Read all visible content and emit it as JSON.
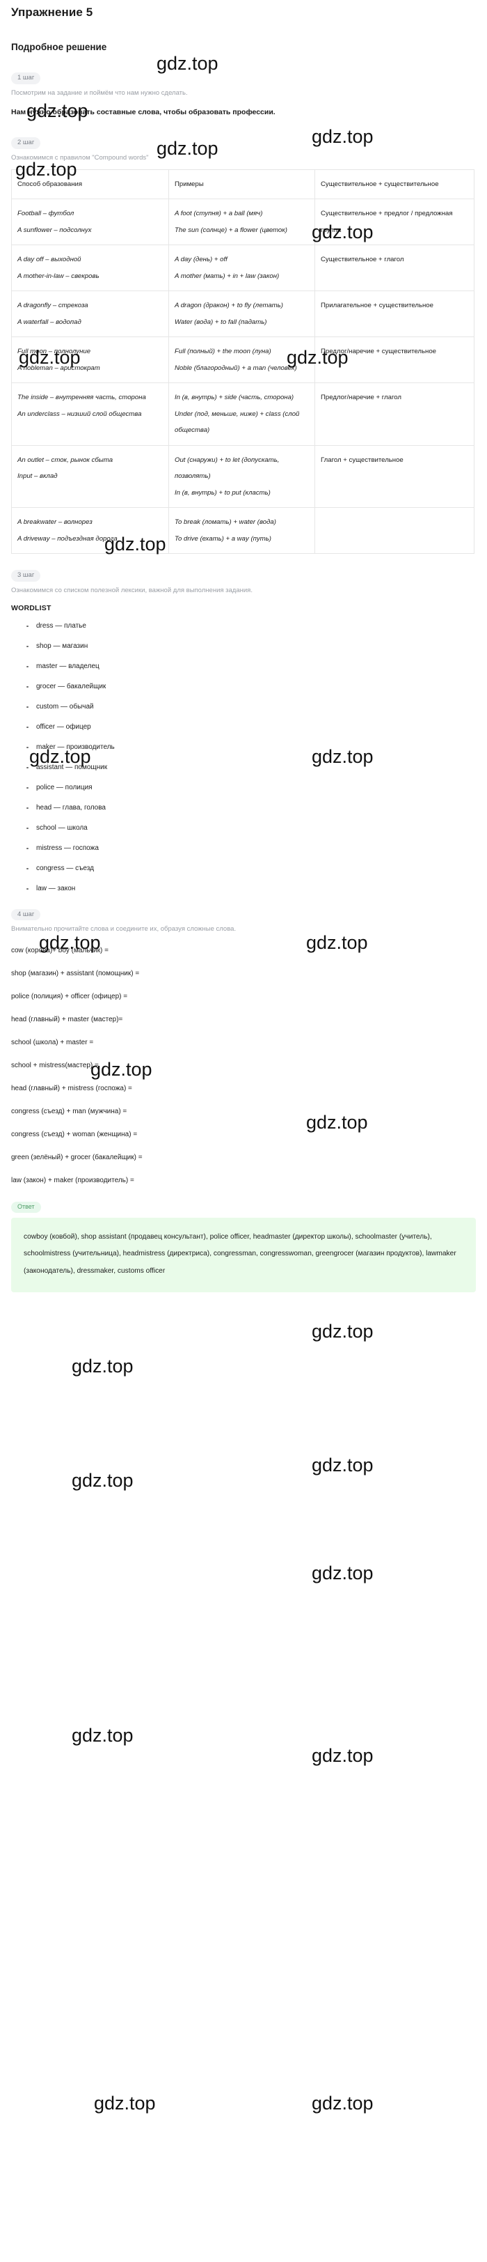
{
  "exercise": {
    "title": "Упражнение 5"
  },
  "solution": {
    "title": "Подробное решение"
  },
  "steps": {
    "step1": {
      "badge": "1 шаг",
      "text": "Посмотрим на задание и поймём что нам нужно сделать.",
      "bold": "Нам нужно образовать составные слова, чтобы образовать профессии."
    },
    "step2": {
      "badge": "2 шаг",
      "text": "Ознакомимся с правилом \"Compound words\""
    },
    "step3": {
      "badge": "3 шаг",
      "text": "Ознакомимся со списком полезной лексики, важной для выполнения задания.",
      "wordlist_title": "WORDLIST"
    },
    "step4": {
      "badge": "4 шаг",
      "text": "Внимательно прочитайте слова и соедините их, образуя сложные слова."
    }
  },
  "table": {
    "headers": [
      "Способ образования",
      "Примеры",
      "Существительное + существительное"
    ],
    "rows": [
      {
        "col1": [
          "Football – футбол",
          "A sunflower – подсолнух"
        ],
        "col2": [
          "A foot (ступня) + a ball (мяч)",
          "The sun (солнце) + a flower (цветок)"
        ],
        "col3": "Существительное + предлог / предложная группа"
      },
      {
        "col1": [
          "A day off – выходной",
          "A mother-in-law – свекровь"
        ],
        "col2": [
          "A day (день) + off",
          "A mother (мать) + in + law (закон)"
        ],
        "col3": "Существительное + глагол"
      },
      {
        "col1": [
          "A dragonfly – стрекоза",
          "A waterfall – водопад"
        ],
        "col2": [
          "A dragon (дракон) + to fly (летать)",
          "Water (вода) + to fall (падать)"
        ],
        "col3": "Прилагательное + существительное"
      },
      {
        "col1": [
          "Full moon – полнолуние",
          "A nobleman – аристократ"
        ],
        "col2": [
          "Full (полный) + the moon (луна)",
          "Noble (благородный) + a man (человек)"
        ],
        "col3": "Предлог/наречие + существительное"
      },
      {
        "col1": [
          "The inside – внутренняя часть, сторона",
          "An underclass – низший слой общества"
        ],
        "col2": [
          "In (в, внутрь) + side (часть, сторона)",
          "Under (под, меньше, ниже) + class (слой общества)"
        ],
        "col3": "Предлог/наречие + глагол"
      },
      {
        "col1": [
          "An outlet – сток, рынок сбыта",
          "Input – вклад"
        ],
        "col2": [
          "Out (снаружи) + to let (допускать, позволять)",
          "In (в, внутрь) + to put (класть)"
        ],
        "col3": "Глагол + существительное"
      },
      {
        "col1": [
          "A breakwater – волнорез",
          "A driveway – подъездная дорога"
        ],
        "col2": [
          "To break (ломать) + water (вода)",
          "To drive (ехать) + a way (путь)"
        ],
        "col3": ""
      }
    ]
  },
  "wordlist": [
    "dress — платье",
    "shop — магазин",
    "master — владелец",
    "grocer — бакалейщик",
    "custom — обычай",
    "officer — офицер",
    "maker — производитель",
    "assistant — помощник",
    "police — полиция",
    "head — глава, голова",
    "school — школа",
    "mistress — госпожа",
    "congress — съезд",
    "law — закон"
  ],
  "pairs": [
    "cow (корова)+ boy (мальчик) =",
    "shop (магазин) + assistant (помощник) =",
    "police (полиция) + officer (офицер) =",
    "head (главный) + master (мастер)=",
    "school (школа) + master =",
    "school + mistress(мастер) =",
    "head (главный) + mistress (госпожа) =",
    "congress (съезд) + man (мужчина) =",
    "congress (съезд) + woman (женщина) =",
    "green (зелёный) + grocer (бакалейщик) =",
    "law (закон) + maker (производитель) ="
  ],
  "answer": {
    "badge": "Ответ",
    "text": "cowboy (ковбой), shop assistant (продавец консультант), police officer, headmaster (директор школы), schoolmaster (учитель), schoolmistress (учительница), headmistress (директриса), congressman, congresswoman, greengrocer (магазин продуктов), lawmaker (законодатель), dressmaker, customs officer"
  },
  "watermark": {
    "label": "gdz.top"
  },
  "colors": {
    "accent_green_bg": "#e9fbe9",
    "badge_bg": "#f1f2f4",
    "badge_text": "#7a7f87",
    "answer_badge_bg": "#e7f8ec",
    "answer_badge_text": "#4d9c66",
    "muted_text": "#9a9ea5",
    "body_text": "#1c1c1c",
    "table_border": "#e6e6e6"
  }
}
